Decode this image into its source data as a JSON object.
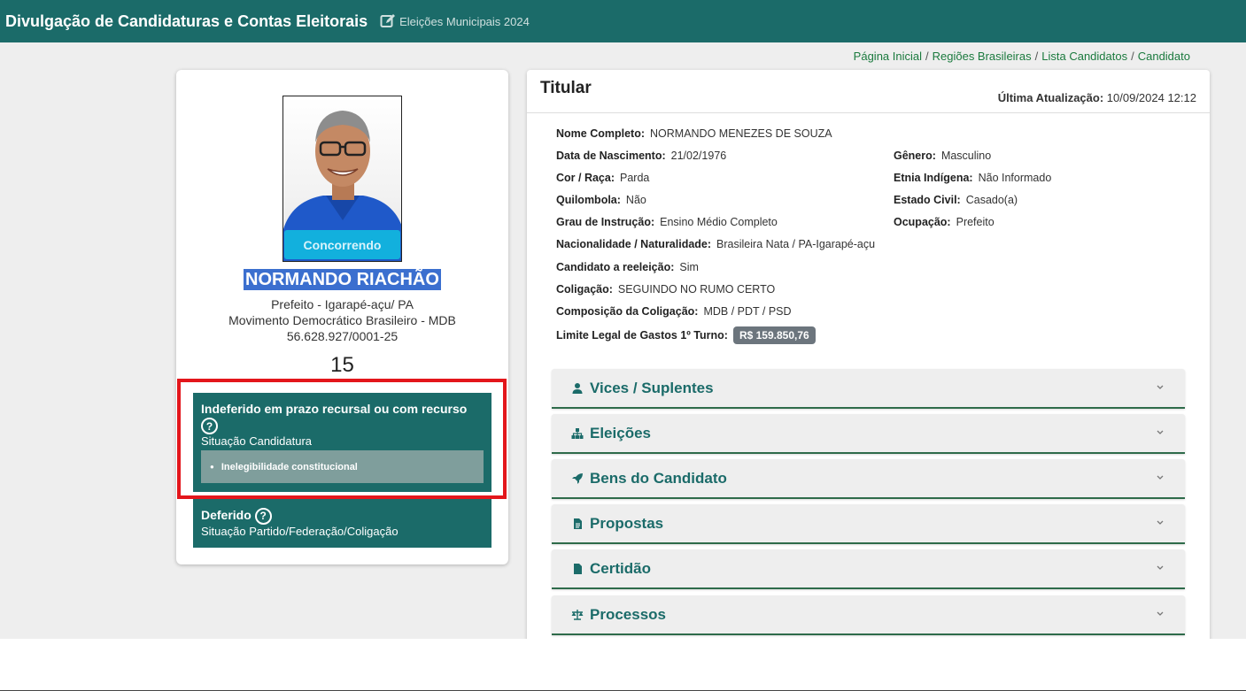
{
  "header": {
    "title": "Divulgação de Candidaturas e Contas Eleitorais",
    "subtitle": "Eleições Municipais 2024",
    "edit_icon": "edit-icon"
  },
  "breadcrumb": [
    {
      "label": "Página Inicial"
    },
    {
      "label": "Regiões Brasileiras"
    },
    {
      "label": "Lista Candidatos"
    },
    {
      "label": "Candidato"
    }
  ],
  "candidate": {
    "status_badge": "Concorrendo",
    "name": "NORMANDO RIACHÃO",
    "office": "Prefeito - Igarapé-açu/ PA",
    "party": "Movimento Democrático Brasileiro - MDB",
    "cnpj": "56.628.927/0001-25",
    "number": "15"
  },
  "situations": {
    "candidacy": {
      "title": "Indeferido em prazo recursal ou com recurso",
      "label": "Situação Candidatura",
      "reason": "Inelegibilidade constitucional"
    },
    "party": {
      "title": "Deferido",
      "label": "Situação Partido/Federação/Coligação"
    }
  },
  "details": {
    "heading": "Titular",
    "updated_label": "Última Atualização:",
    "updated_value": "10/09/2024 12:12",
    "fields": {
      "nome": {
        "label": "Nome Completo:",
        "value": "NORMANDO MENEZES DE SOUZA"
      },
      "nascimento": {
        "label": "Data de Nascimento:",
        "value": "21/02/1976"
      },
      "genero": {
        "label": "Gênero:",
        "value": "Masculino"
      },
      "cor": {
        "label": "Cor / Raça:",
        "value": "Parda"
      },
      "etnia": {
        "label": "Etnia Indígena:",
        "value": "Não Informado"
      },
      "quilombola": {
        "label": "Quilombola:",
        "value": "Não"
      },
      "estado_civil": {
        "label": "Estado Civil:",
        "value": "Casado(a)"
      },
      "instrucao": {
        "label": "Grau de Instrução:",
        "value": "Ensino Médio Completo"
      },
      "ocupacao": {
        "label": "Ocupação:",
        "value": "Prefeito"
      },
      "nacionalidade": {
        "label": "Nacionalidade / Naturalidade:",
        "value": "Brasileira Nata / PA-Igarapé-açu"
      },
      "reeleicao": {
        "label": "Candidato a reeleição:",
        "value": "Sim"
      },
      "coligacao": {
        "label": "Coligação:",
        "value": "SEGUINDO NO RUMO CERTO"
      },
      "composicao": {
        "label": "Composição da Coligação:",
        "value": "MDB / PDT / PSD"
      },
      "limite": {
        "label": "Limite Legal de Gastos 1º Turno:",
        "value": "R$ 159.850,76"
      }
    }
  },
  "accordions": [
    {
      "label": "Vices / Suplentes",
      "icon": "user-icon"
    },
    {
      "label": "Eleições",
      "icon": "sitemap-icon"
    },
    {
      "label": "Bens do Candidato",
      "icon": "rocket-icon"
    },
    {
      "label": "Propostas",
      "icon": "file-text-icon"
    },
    {
      "label": "Certidão",
      "icon": "file-icon"
    },
    {
      "label": "Processos",
      "icon": "scale-icon"
    }
  ],
  "colors": {
    "header_bg": "#1b6b69",
    "status_bg": "#1b6b69",
    "badge_bg": "#12b0dd",
    "highlight": "#e3161b"
  }
}
